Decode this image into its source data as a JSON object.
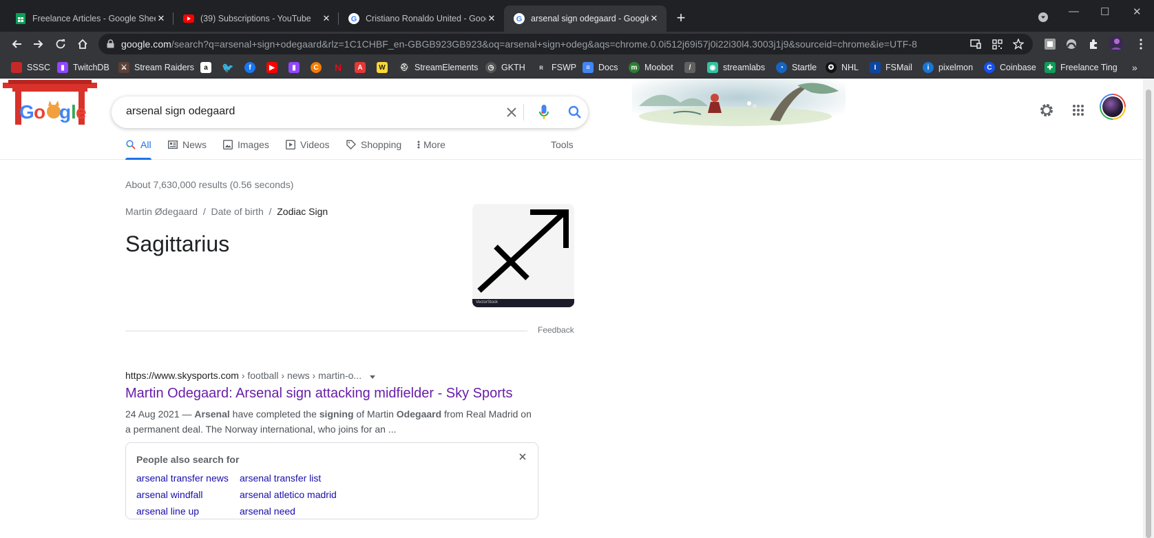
{
  "tabs": [
    {
      "title": "Freelance Articles - Google Sheets",
      "icon": "google-sheets-icon"
    },
    {
      "title": "(39) Subscriptions - YouTube",
      "icon": "youtube-icon"
    },
    {
      "title": "Cristiano Ronaldo United - Google Search",
      "icon": "google-icon"
    },
    {
      "title": "arsenal sign odegaard - Google Search",
      "icon": "google-icon"
    }
  ],
  "omnibox": {
    "host": "google.com",
    "path": "/search?q=arsenal+sign+odegaard&rlz=1C1CHBF_en-GBGB923GB923&oq=arsenal+sign+odeg&aqs=chrome.0.0i512j69i57j0i22i30l4.3003j1j9&sourceid=chrome&ie=UTF-8"
  },
  "bookmarks": [
    {
      "label": "SSSC",
      "color": "#c62828"
    },
    {
      "label": "TwitchDB",
      "color": "#9146ff"
    },
    {
      "label": "Stream Raiders",
      "color": "#5d4037"
    },
    {
      "label": "",
      "color": "#ffffff"
    },
    {
      "label": "",
      "color": "#1da1f2"
    },
    {
      "label": "",
      "color": "#1877f2"
    },
    {
      "label": "",
      "color": "#ff0000"
    },
    {
      "label": "",
      "color": "#9146ff"
    },
    {
      "label": "",
      "color": "#f57c00"
    },
    {
      "label": "",
      "color": "#e50914"
    },
    {
      "label": "",
      "color": "#e53935"
    },
    {
      "label": "",
      "color": "#fdd835"
    },
    {
      "label": "StreamElements",
      "color": "#3b3b3b"
    },
    {
      "label": "GKTH",
      "color": "#555555"
    },
    {
      "label": "FSWP",
      "color": "#444444"
    },
    {
      "label": "Docs",
      "color": "#4285f4"
    },
    {
      "label": "Moobot",
      "color": "#2e7d32"
    },
    {
      "label": "",
      "color": "#616161"
    },
    {
      "label": "streamlabs",
      "color": "#31c3a2"
    },
    {
      "label": "Startle",
      "color": "#1565c0"
    },
    {
      "label": "NHL",
      "color": "#111111"
    },
    {
      "label": "FSMail",
      "color": "#0d47a1"
    },
    {
      "label": "pixelmon",
      "color": "#1976d2"
    },
    {
      "label": "Coinbase",
      "color": "#1652f0"
    },
    {
      "label": "Freelance Ting",
      "color": "#0f9d58"
    }
  ],
  "search": {
    "query": "arsenal sign odegaard"
  },
  "search_tabs": [
    {
      "label": "All",
      "icon": "search-icon"
    },
    {
      "label": "News",
      "icon": "news-icon"
    },
    {
      "label": "Images",
      "icon": "image-icon"
    },
    {
      "label": "Videos",
      "icon": "video-icon"
    },
    {
      "label": "Shopping",
      "icon": "tag-icon"
    },
    {
      "label": "More",
      "icon": "more-vert-icon"
    },
    {
      "label": "Tools",
      "icon": ""
    }
  ],
  "result_stats": "About 7,630,000 results (0.56 seconds)",
  "knowledge_panel": {
    "breadcrumb": [
      "Martin Ødegaard",
      "Date of birth",
      "Zodiac Sign"
    ],
    "answer": "Sagittarius",
    "image_caption": "VectorStock",
    "feedback": "Feedback"
  },
  "result": {
    "cite_host": "https://www.skysports.com",
    "cite_path": " › football › news › martin-o...",
    "title": "Martin Odegaard: Arsenal sign attacking midfielder - Sky Sports",
    "date": "24 Aug 2021 — ",
    "snippet_parts": [
      {
        "text": "Arsenal",
        "bold": true
      },
      {
        "text": " have completed the ",
        "bold": false
      },
      {
        "text": "signing",
        "bold": true
      },
      {
        "text": " of Martin ",
        "bold": false
      },
      {
        "text": "Odegaard",
        "bold": true
      },
      {
        "text": " from Real Madrid on a permanent deal. The Norway international, who joins for an ...",
        "bold": false
      }
    ]
  },
  "people_also_search": {
    "title": "People also search for",
    "links": [
      "arsenal transfer news",
      "arsenal transfer list",
      "arsenal windfall",
      "arsenal atletico madrid",
      "arsenal line up",
      "arsenal need"
    ]
  },
  "colors": {
    "link_blue": "#1a0dab",
    "visited": "#681da8",
    "accent": "#1a73e8"
  }
}
